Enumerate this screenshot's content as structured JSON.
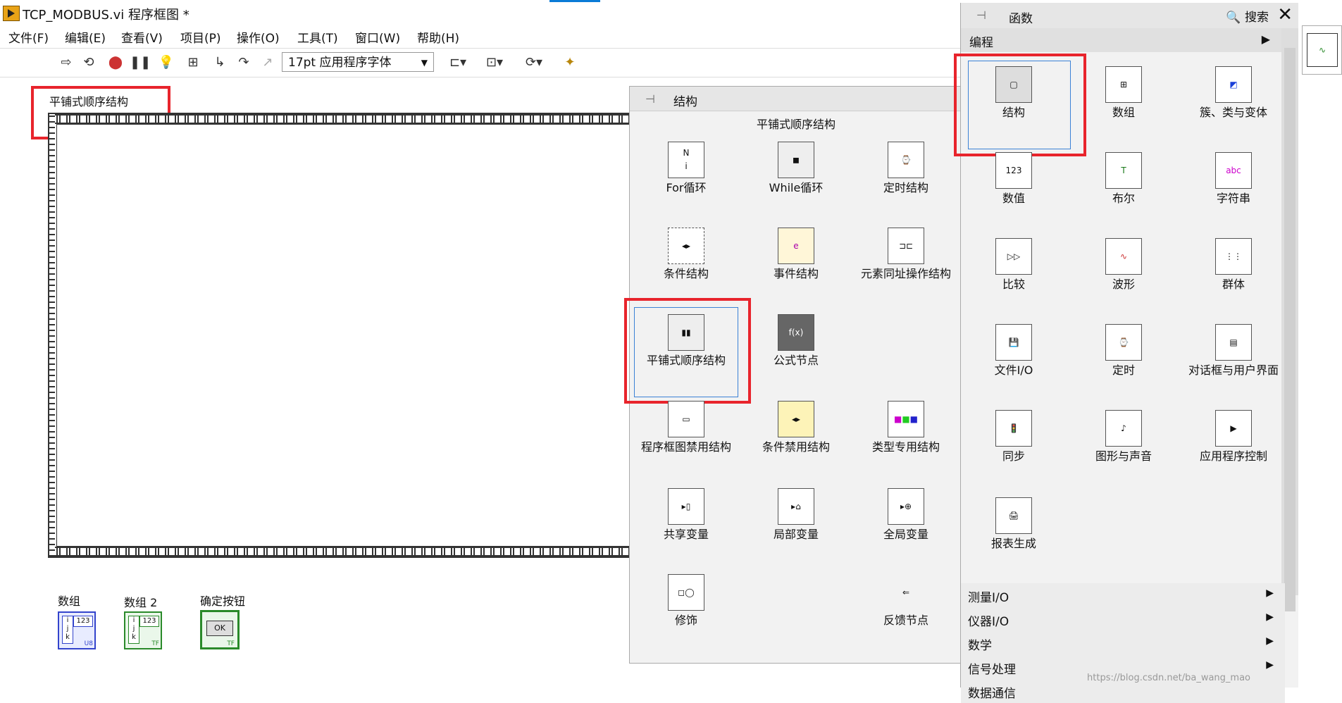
{
  "window": {
    "title": "TCP_MODBUS.vi 程序框图 *"
  },
  "menu": [
    "文件(F)",
    "编辑(E)",
    "查看(V)",
    "项目(P)",
    "操作(O)",
    "工具(T)",
    "窗口(W)",
    "帮助(H)"
  ],
  "toolbar": {
    "font_select": "17pt 应用程序字体"
  },
  "diagram": {
    "sequence_label": "平铺式顺序结构",
    "terminals": [
      {
        "label": "数组",
        "icon_text": "123",
        "type_text": "U8"
      },
      {
        "label": "数组 2",
        "icon_text": "123",
        "type_text": "TF"
      },
      {
        "label": "确定按钮",
        "icon_text": "OK",
        "type_text": "TF"
      }
    ]
  },
  "structures_palette": {
    "title": "结构",
    "tooltip": "平铺式顺序结构",
    "items": [
      "For循环",
      "While循环",
      "定时结构",
      "条件结构",
      "事件结构",
      "元素同址操作结构",
      "平铺式顺序结构",
      "公式节点",
      "",
      "程序框图禁用结构",
      "条件禁用结构",
      "类型专用结构",
      "共享变量",
      "局部变量",
      "全局变量",
      "修饰",
      "",
      "反馈节点"
    ]
  },
  "functions_palette": {
    "title": "函数",
    "search": "搜索",
    "category": "编程",
    "items": [
      "结构",
      "数组",
      "簇、类与变体",
      "数值",
      "布尔",
      "字符串",
      "比较",
      "波形",
      "群体",
      "文件I/O",
      "定时",
      "对话框与用户界面",
      "同步",
      "图形与声音",
      "应用程序控制",
      "报表生成"
    ],
    "categories": [
      "测量I/O",
      "仪器I/O",
      "数学",
      "信号处理",
      "数据通信"
    ]
  },
  "watermark": "https://blog.csdn.net/ba_wang_mao"
}
